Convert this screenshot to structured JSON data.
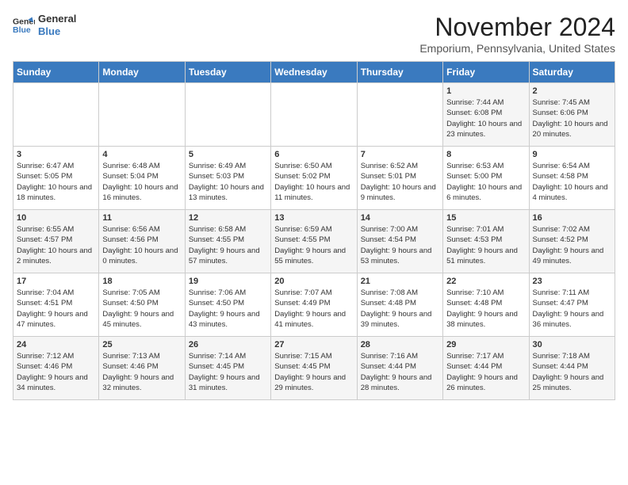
{
  "header": {
    "logo_line1": "General",
    "logo_line2": "Blue",
    "month": "November 2024",
    "location": "Emporium, Pennsylvania, United States"
  },
  "days_of_week": [
    "Sunday",
    "Monday",
    "Tuesday",
    "Wednesday",
    "Thursday",
    "Friday",
    "Saturday"
  ],
  "weeks": [
    [
      {
        "day": "",
        "info": ""
      },
      {
        "day": "",
        "info": ""
      },
      {
        "day": "",
        "info": ""
      },
      {
        "day": "",
        "info": ""
      },
      {
        "day": "",
        "info": ""
      },
      {
        "day": "1",
        "info": "Sunrise: 7:44 AM\nSunset: 6:08 PM\nDaylight: 10 hours and 23 minutes."
      },
      {
        "day": "2",
        "info": "Sunrise: 7:45 AM\nSunset: 6:06 PM\nDaylight: 10 hours and 20 minutes."
      }
    ],
    [
      {
        "day": "3",
        "info": "Sunrise: 6:47 AM\nSunset: 5:05 PM\nDaylight: 10 hours and 18 minutes."
      },
      {
        "day": "4",
        "info": "Sunrise: 6:48 AM\nSunset: 5:04 PM\nDaylight: 10 hours and 16 minutes."
      },
      {
        "day": "5",
        "info": "Sunrise: 6:49 AM\nSunset: 5:03 PM\nDaylight: 10 hours and 13 minutes."
      },
      {
        "day": "6",
        "info": "Sunrise: 6:50 AM\nSunset: 5:02 PM\nDaylight: 10 hours and 11 minutes."
      },
      {
        "day": "7",
        "info": "Sunrise: 6:52 AM\nSunset: 5:01 PM\nDaylight: 10 hours and 9 minutes."
      },
      {
        "day": "8",
        "info": "Sunrise: 6:53 AM\nSunset: 5:00 PM\nDaylight: 10 hours and 6 minutes."
      },
      {
        "day": "9",
        "info": "Sunrise: 6:54 AM\nSunset: 4:58 PM\nDaylight: 10 hours and 4 minutes."
      }
    ],
    [
      {
        "day": "10",
        "info": "Sunrise: 6:55 AM\nSunset: 4:57 PM\nDaylight: 10 hours and 2 minutes."
      },
      {
        "day": "11",
        "info": "Sunrise: 6:56 AM\nSunset: 4:56 PM\nDaylight: 10 hours and 0 minutes."
      },
      {
        "day": "12",
        "info": "Sunrise: 6:58 AM\nSunset: 4:55 PM\nDaylight: 9 hours and 57 minutes."
      },
      {
        "day": "13",
        "info": "Sunrise: 6:59 AM\nSunset: 4:55 PM\nDaylight: 9 hours and 55 minutes."
      },
      {
        "day": "14",
        "info": "Sunrise: 7:00 AM\nSunset: 4:54 PM\nDaylight: 9 hours and 53 minutes."
      },
      {
        "day": "15",
        "info": "Sunrise: 7:01 AM\nSunset: 4:53 PM\nDaylight: 9 hours and 51 minutes."
      },
      {
        "day": "16",
        "info": "Sunrise: 7:02 AM\nSunset: 4:52 PM\nDaylight: 9 hours and 49 minutes."
      }
    ],
    [
      {
        "day": "17",
        "info": "Sunrise: 7:04 AM\nSunset: 4:51 PM\nDaylight: 9 hours and 47 minutes."
      },
      {
        "day": "18",
        "info": "Sunrise: 7:05 AM\nSunset: 4:50 PM\nDaylight: 9 hours and 45 minutes."
      },
      {
        "day": "19",
        "info": "Sunrise: 7:06 AM\nSunset: 4:50 PM\nDaylight: 9 hours and 43 minutes."
      },
      {
        "day": "20",
        "info": "Sunrise: 7:07 AM\nSunset: 4:49 PM\nDaylight: 9 hours and 41 minutes."
      },
      {
        "day": "21",
        "info": "Sunrise: 7:08 AM\nSunset: 4:48 PM\nDaylight: 9 hours and 39 minutes."
      },
      {
        "day": "22",
        "info": "Sunrise: 7:10 AM\nSunset: 4:48 PM\nDaylight: 9 hours and 38 minutes."
      },
      {
        "day": "23",
        "info": "Sunrise: 7:11 AM\nSunset: 4:47 PM\nDaylight: 9 hours and 36 minutes."
      }
    ],
    [
      {
        "day": "24",
        "info": "Sunrise: 7:12 AM\nSunset: 4:46 PM\nDaylight: 9 hours and 34 minutes."
      },
      {
        "day": "25",
        "info": "Sunrise: 7:13 AM\nSunset: 4:46 PM\nDaylight: 9 hours and 32 minutes."
      },
      {
        "day": "26",
        "info": "Sunrise: 7:14 AM\nSunset: 4:45 PM\nDaylight: 9 hours and 31 minutes."
      },
      {
        "day": "27",
        "info": "Sunrise: 7:15 AM\nSunset: 4:45 PM\nDaylight: 9 hours and 29 minutes."
      },
      {
        "day": "28",
        "info": "Sunrise: 7:16 AM\nSunset: 4:44 PM\nDaylight: 9 hours and 28 minutes."
      },
      {
        "day": "29",
        "info": "Sunrise: 7:17 AM\nSunset: 4:44 PM\nDaylight: 9 hours and 26 minutes."
      },
      {
        "day": "30",
        "info": "Sunrise: 7:18 AM\nSunset: 4:44 PM\nDaylight: 9 hours and 25 minutes."
      }
    ]
  ]
}
